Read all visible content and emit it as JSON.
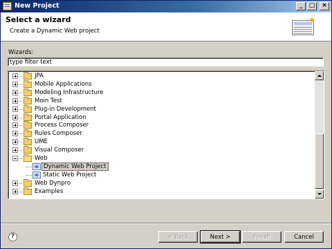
{
  "window": {
    "title": "New Project"
  },
  "title_buttons": {
    "minimize": "_",
    "maximize": "□",
    "close": "×"
  },
  "header": {
    "title": "Select a wizard",
    "subtitle": "Create a Dynamic Web project"
  },
  "wizards": {
    "label": "Wizards:",
    "filter_value": "type filter text"
  },
  "tree": {
    "items": [
      {
        "label": "JPA",
        "state": "collapsed"
      },
      {
        "label": "Mobile Applications",
        "state": "collapsed"
      },
      {
        "label": "Modeling Infrastructure",
        "state": "collapsed"
      },
      {
        "label": "Moin Test",
        "state": "collapsed"
      },
      {
        "label": "Plug-in Development",
        "state": "collapsed"
      },
      {
        "label": "Portal Application",
        "state": "collapsed"
      },
      {
        "label": "Process Composer",
        "state": "collapsed"
      },
      {
        "label": "Rules Composer",
        "state": "collapsed"
      },
      {
        "label": "UME",
        "state": "collapsed"
      },
      {
        "label": "Visual Composer",
        "state": "collapsed"
      },
      {
        "label": "Web",
        "state": "expanded"
      },
      {
        "label": "Dynamic Web Project",
        "child": true,
        "selected": true
      },
      {
        "label": "Static Web Project",
        "child": true
      },
      {
        "label": "Web Dynpro",
        "state": "collapsed"
      },
      {
        "label": "Examples",
        "state": "collapsed"
      }
    ]
  },
  "buttons": {
    "help": "?",
    "back": "< Back",
    "next": "Next >",
    "finish": "Finish",
    "cancel": "Cancel"
  }
}
